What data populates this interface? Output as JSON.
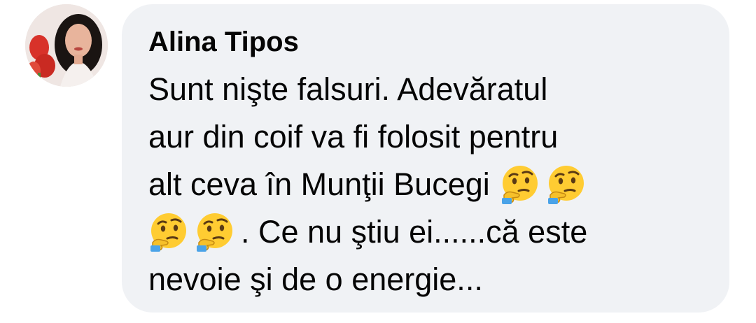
{
  "comment": {
    "author": "Alina Tipos",
    "avatar_icon": "profile-photo",
    "lines": [
      "Sunt nişte falsuri. Adevăratul",
      "aur din coif va fi folosit pentru",
      "alt ceva în Munţii Bucegi",
      ". Ce nu ştiu ei......că este",
      "nevoie şi de o energie..."
    ],
    "emoji": {
      "name": "thinking-face",
      "count_line3": 2,
      "count_line4": 2
    },
    "colors": {
      "bubble": "#f0f2f5",
      "text": "#050505",
      "emoji_face": "#ffcc32"
    }
  }
}
